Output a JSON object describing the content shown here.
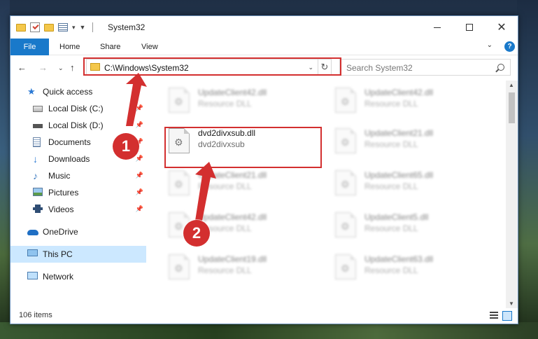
{
  "window": {
    "title": "System32",
    "minimize_glyph": "",
    "close_glyph": "✕"
  },
  "ribbon": {
    "tabs": [
      "File",
      "Home",
      "Share",
      "View"
    ],
    "help": "?"
  },
  "address": {
    "path": "C:\\Windows\\System32",
    "search_placeholder": "Search System32"
  },
  "navpane": {
    "items": [
      {
        "label": "Quick access",
        "icon": "star-icon",
        "pinned": false
      },
      {
        "label": "Local Disk (C:)",
        "icon": "disk-icon",
        "pinned": true
      },
      {
        "label": "Local Disk (D:)",
        "icon": "disk-icon",
        "pinned": true
      },
      {
        "label": "Documents",
        "icon": "documents-icon",
        "pinned": true
      },
      {
        "label": "Downloads",
        "icon": "downloads-icon",
        "pinned": true
      },
      {
        "label": "Music",
        "icon": "music-icon",
        "pinned": true
      },
      {
        "label": "Pictures",
        "icon": "pictures-icon",
        "pinned": true
      },
      {
        "label": "Videos",
        "icon": "videos-icon",
        "pinned": true
      },
      {
        "label": "OneDrive",
        "icon": "onedrive-icon",
        "pinned": false
      },
      {
        "label": "This PC",
        "icon": "this-pc-icon",
        "pinned": false,
        "selected": true
      },
      {
        "label": "Network",
        "icon": "network-icon",
        "pinned": false
      }
    ]
  },
  "files": [
    {
      "name": "UpdateClient42.dll",
      "type": "Resource DLL",
      "blurred": true
    },
    {
      "name": "UpdateClient42.dll",
      "type": "Resource DLL",
      "blurred": true
    },
    {
      "name": "dvd2divxsub.dll",
      "type": "dvd2divxsub",
      "blurred": false
    },
    {
      "name": "UpdateClient21.dll",
      "type": "Resource DLL",
      "blurred": true
    },
    {
      "name": "UpdateClient21.dll",
      "type": "Resource DLL",
      "blurred": true
    },
    {
      "name": "UpdateClient65.dll",
      "type": "Resource DLL",
      "blurred": true
    },
    {
      "name": "UpdateClient42.dll",
      "type": "Resource DLL",
      "blurred": true
    },
    {
      "name": "UpdateClient5.dll",
      "type": "Resource DLL",
      "blurred": true
    },
    {
      "name": "UpdateClient19.dll",
      "type": "Resource DLL",
      "blurred": true
    },
    {
      "name": "UpdateClient63.dll",
      "type": "Resource DLL",
      "blurred": true
    }
  ],
  "status": {
    "item_count": "106 items"
  },
  "annotations": {
    "badge_1": "1",
    "badge_2": "2",
    "highlight_color": "#d32f2f"
  }
}
